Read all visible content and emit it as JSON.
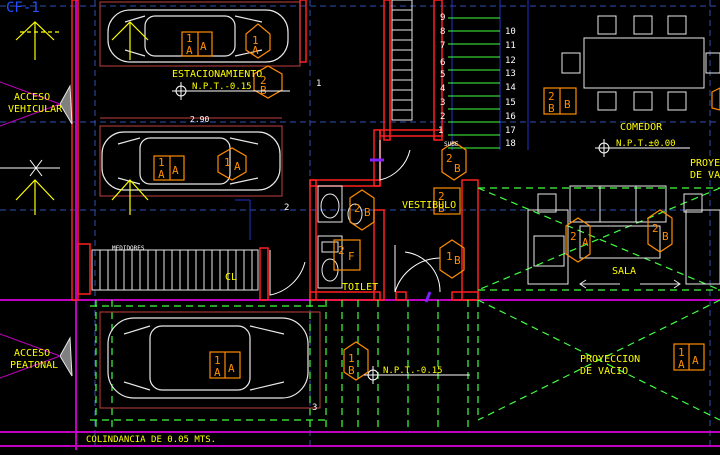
{
  "sheet": {
    "code": "CF-1"
  },
  "labels": {
    "acceso_vehicular_1": "ACCESO",
    "acceso_vehicular_2": "VEHICULAR",
    "acceso_peatonal_1": "ACCESO",
    "acceso_peatonal_2": "PEATONAL",
    "estacionamiento": "ESTACIONAMIENTO",
    "medidores": "MEDIDORES",
    "vestibulo": "VESTIBULO",
    "toilet": "TOILET",
    "comedor": "COMEDOR",
    "sala": "SALA",
    "proyeccion_1": "PROYECCION",
    "proyeccion_2": "DE VACIO",
    "proyeccion_r1": "PROYEC",
    "proyeccion_r2": "DE VA",
    "sube": "SUBE",
    "colindancia": "COLINDANCIA DE 0.05 MTS.",
    "cl": "CL",
    "dim_top": "2.90"
  },
  "levels": {
    "parking": "N.P.T.-0.15",
    "comedor": "N.P.T.±0.00",
    "patio": "N.P.T.-0.15"
  },
  "stair_steps": {
    "left": [
      "9",
      "8",
      "7",
      "6",
      "5",
      "4",
      "3",
      "2",
      "1"
    ],
    "right": [
      "10",
      "11",
      "12",
      "13",
      "14",
      "15",
      "16",
      "17",
      "18"
    ]
  },
  "tags": {
    "A": "A",
    "B": "B",
    "F": "F",
    "n1": "1",
    "n2": "2"
  },
  "misc": {
    "one": "1",
    "two": "2",
    "three": "3"
  },
  "colors": {
    "background": "#000000",
    "walls": "#ff2020",
    "magenta": "#c000c0",
    "text": "#ffff00",
    "furniture": "#e8e8e8",
    "tags": "#ff8c00",
    "hatch": "#40ff40",
    "grid": "#3050b0",
    "dim": "#c04040"
  }
}
